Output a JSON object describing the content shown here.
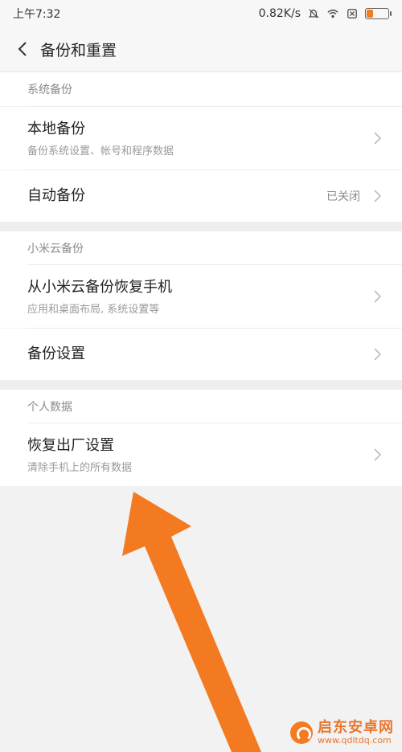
{
  "status_bar": {
    "time": "上午7:32",
    "net_speed": "0.82K/s",
    "icons": [
      "mute-icon",
      "wifi-icon",
      "sim-x-icon",
      "battery-icon"
    ],
    "battery_level": 0.3,
    "battery_color": "#f47b20"
  },
  "header": {
    "back_icon": "chevron-left-icon",
    "title": "备份和重置"
  },
  "sections": [
    {
      "header": "系统备份",
      "items": [
        {
          "label": "本地备份",
          "sub": "备份系统设置、帐号和程序数据"
        },
        {
          "label": "自动备份",
          "value": "已关闭"
        }
      ]
    },
    {
      "header": "小米云备份",
      "items": [
        {
          "label": "从小米云备份恢复手机",
          "sub": "应用和桌面布局, 系统设置等"
        },
        {
          "label": "备份设置"
        }
      ]
    },
    {
      "header": "个人数据",
      "items": [
        {
          "label": "恢复出厂设置",
          "sub": "清除手机上的所有数据"
        }
      ]
    }
  ],
  "annotation": {
    "arrow_color": "#f47a22"
  },
  "watermark": {
    "name": "启东安卓网",
    "url": "www.qdltdq.com"
  }
}
